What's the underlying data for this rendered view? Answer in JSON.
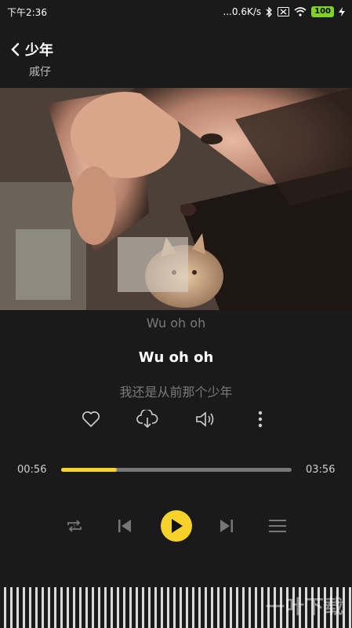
{
  "status_bar": {
    "time": "下午2:36",
    "network_speed": "...0.6K/s",
    "battery": "100"
  },
  "header": {
    "title": "少年",
    "artist": "戚仔"
  },
  "lyrics": {
    "previous": "Wu oh oh",
    "current": "Wu oh oh",
    "next": "我还是从前那个少年"
  },
  "progress": {
    "elapsed": "00:56",
    "total": "03:56",
    "fraction": 0.24
  },
  "colors": {
    "accent": "#f6d22a",
    "background": "#1a1a1a"
  },
  "watermark": "一叶下载",
  "icons": {
    "back": "chevron-left-icon",
    "like": "heart-icon",
    "download": "cloud-download-icon",
    "volume": "speaker-icon",
    "more": "more-vertical-icon",
    "repeat": "repeat-one-icon",
    "prev": "skip-previous-icon",
    "play": "play-icon",
    "next": "skip-next-icon",
    "playlist": "playlist-icon"
  }
}
